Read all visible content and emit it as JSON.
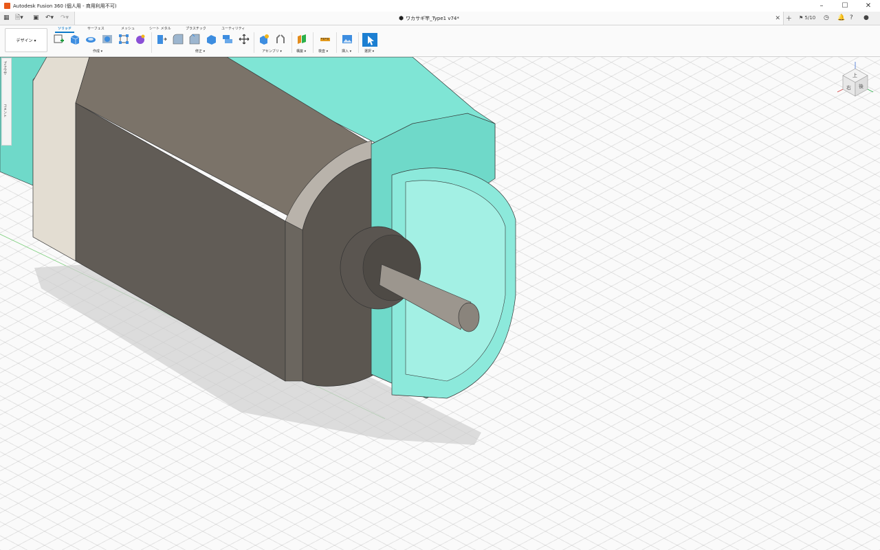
{
  "window": {
    "title": "Autodesk Fusion 360 (個人用 - 商用利用不可)"
  },
  "document": {
    "name": "ワカサギ竿_Type1 v74*",
    "version_count": "5/10"
  },
  "workspace": {
    "label": "デザイン ▾"
  },
  "ribbon": {
    "tabs": [
      "ソリッド",
      "サーフェス",
      "メッシュ",
      "シート メタル",
      "プラスチック",
      "ユーティリティ"
    ],
    "groups": {
      "create": "作成 ▾",
      "modify": "修正 ▾",
      "assemble": "アセンブリ ▾",
      "construct": "構築 ▾",
      "inspect": "検査 ▾",
      "insert": "挿入 ▾",
      "select": "選択 ▾"
    }
  },
  "browser": {
    "label": "ブラウザ",
    "comments": "コメント"
  },
  "viewcube": {
    "top": "上",
    "right": "右",
    "back": "後"
  },
  "colors": {
    "accent": "#0a78c8",
    "body_teal": "#7fe2d2",
    "motor_dark": "#6a655e",
    "motor_light": "#e3ddd2"
  }
}
